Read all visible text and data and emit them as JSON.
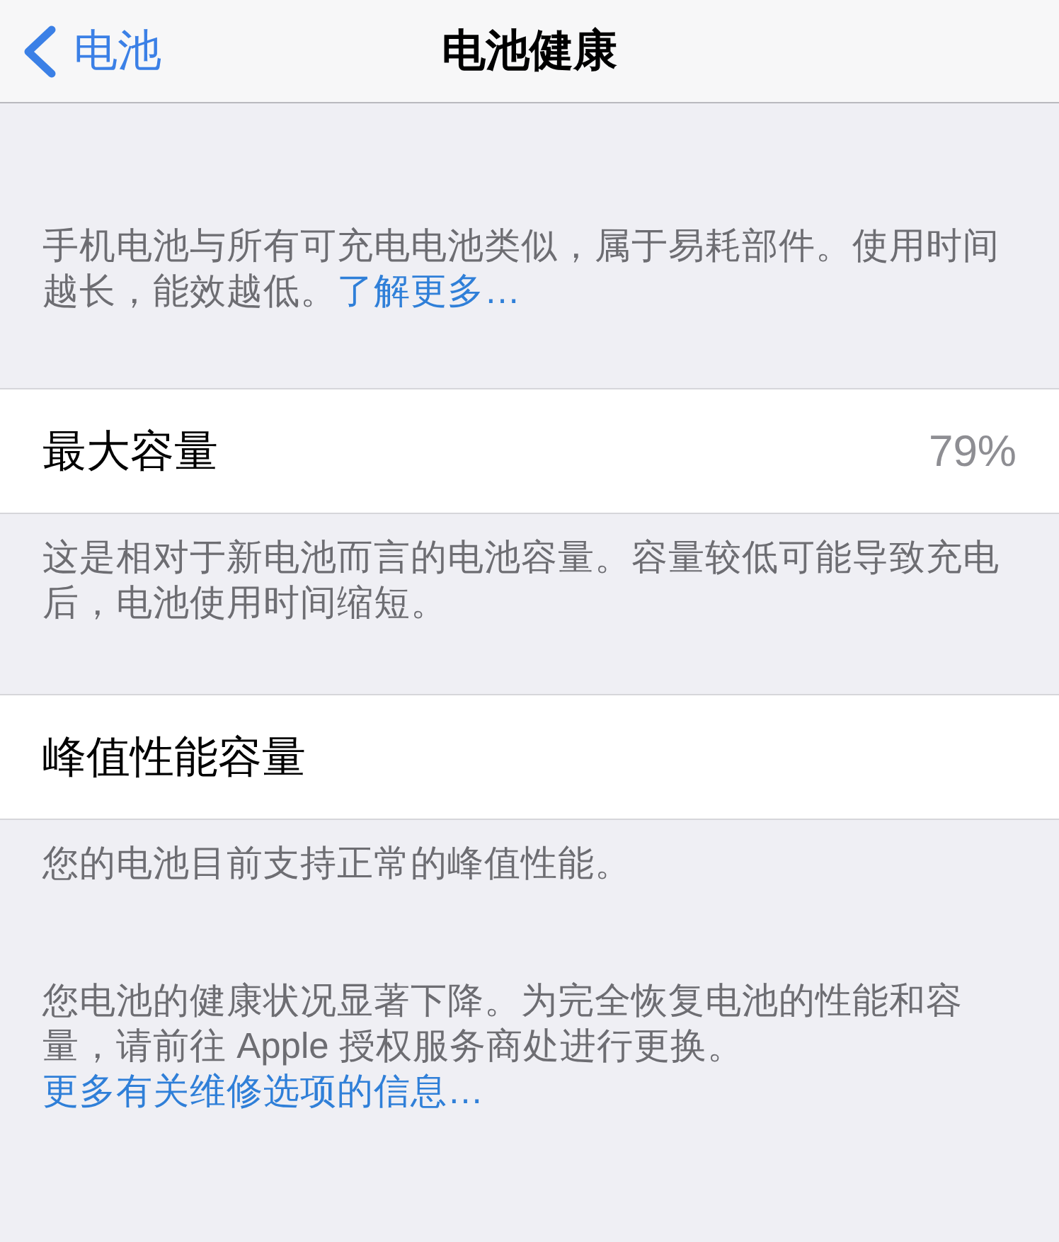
{
  "nav_bar": {
    "back_label": "电池",
    "title": "电池健康"
  },
  "intro": {
    "text": "手机电池与所有可充电电池类似，属于易耗部件。使用时间越长，能效越低。",
    "link": "了解更多…"
  },
  "rows": [
    {
      "label": "最大容量",
      "value": "79%",
      "note": "这是相对于新电池而言的电池容量。容量较低可能导致充电后，电池使用时间缩短。"
    },
    {
      "label": "峰值性能容量",
      "note": "您的电池目前支持正常的峰值性能。"
    }
  ],
  "warning": {
    "text": "您电池的健康状况显著下降。为完全恢复电池的性能和容量，请前往 Apple 授权服务商处进行更换。",
    "link": "更多有关维修选项的信息…"
  }
}
